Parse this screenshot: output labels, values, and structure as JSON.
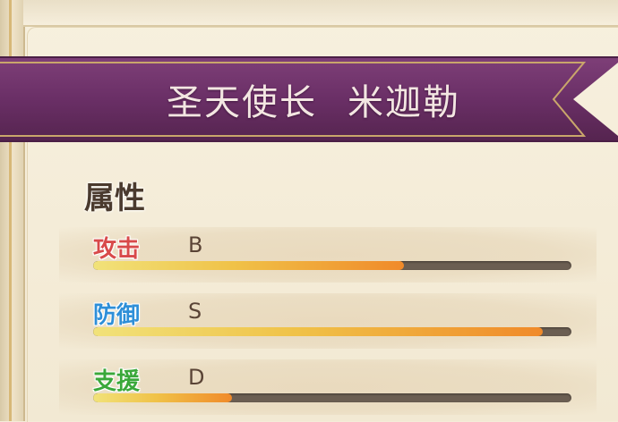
{
  "header": {
    "title_rank": "圣天使长",
    "title_name": "米迦勒"
  },
  "attributes": {
    "section_title": "属性",
    "stats": [
      {
        "label": "攻击",
        "grade": "B",
        "fill": 0.65,
        "label_color": "#d84a4a"
      },
      {
        "label": "防御",
        "grade": "S",
        "fill": 0.94,
        "label_color": "#2e8fd8"
      },
      {
        "label": "支援",
        "grade": "D",
        "fill": 0.29,
        "label_color": "#3aa83a"
      }
    ]
  }
}
